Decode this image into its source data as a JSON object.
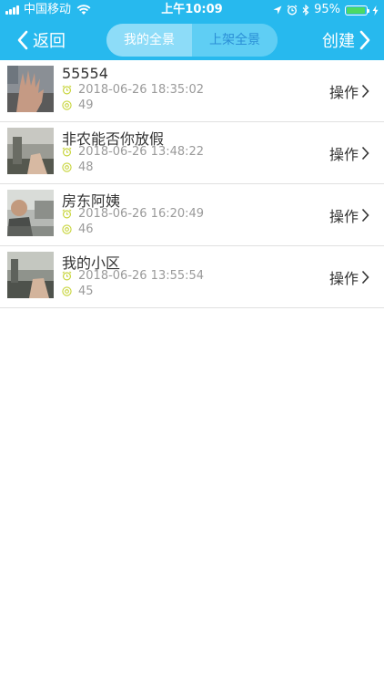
{
  "status": {
    "carrier": "中国移动",
    "time": "上午10:09",
    "battery": "95%",
    "battery_level": 0.95
  },
  "nav": {
    "back_label": "返回",
    "create_label": "创建",
    "tabs": [
      {
        "label": "我的全景",
        "active": true
      },
      {
        "label": "上架全景",
        "active": false
      }
    ]
  },
  "items": [
    {
      "title": "55554",
      "time": "2018-06-26 18:35:02",
      "views": "49",
      "action": "操作"
    },
    {
      "title": "非农能否你放假",
      "time": "2018-06-26 13:48:22",
      "views": "48",
      "action": "操作"
    },
    {
      "title": "房东阿姨",
      "time": "2018-06-26 16:20:49",
      "views": "46",
      "action": "操作"
    },
    {
      "title": "我的小区",
      "time": "2018-06-26 13:55:54",
      "views": "45",
      "action": "操作"
    }
  ],
  "colors": {
    "nav_bg": "#27b9ee",
    "icon_accent": "#c7d43a"
  }
}
